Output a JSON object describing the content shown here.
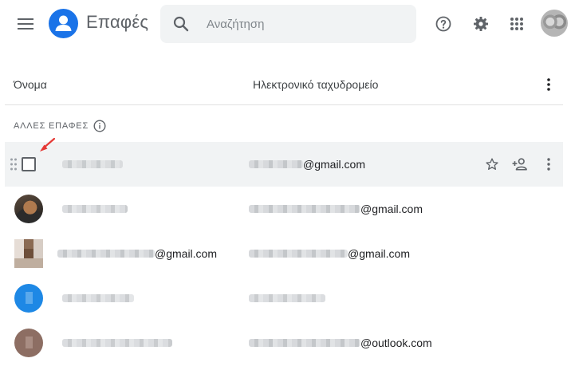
{
  "header": {
    "app_title": "Επαφές",
    "search_placeholder": "Αναζήτηση",
    "icons": [
      "menu-icon",
      "contacts-logo-icon",
      "search-icon",
      "help-icon",
      "settings-icon",
      "apps-grid-icon"
    ],
    "brand_color": "#1a73e8"
  },
  "columns": {
    "name": "Όνομα",
    "email": "Ηλεκτρονικό ταχυδρομείο"
  },
  "section": {
    "label": "ΑΛΛΕΣ ΕΠΑΦΕΣ"
  },
  "rows": [
    {
      "name": "",
      "email_domain": "@gmail.com",
      "avatar": "checkbox"
    },
    {
      "name": "",
      "email_domain": "@gmail.com",
      "avatar": "photo"
    },
    {
      "name_domain": "@gmail.com",
      "email_domain": "@gmail.com",
      "avatar": "pixelated"
    },
    {
      "name": "",
      "email_domain": "",
      "avatar": "blue"
    },
    {
      "name": "",
      "email_domain": "@outlook.com",
      "avatar": "brown"
    }
  ]
}
